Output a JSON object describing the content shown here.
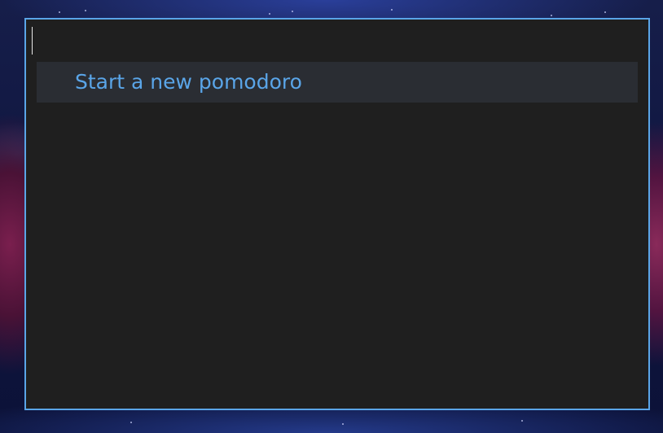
{
  "launcher": {
    "search": {
      "value": "",
      "placeholder": ""
    },
    "results": [
      {
        "label": "Start a new pomodoro",
        "selected": true
      }
    ]
  },
  "colors": {
    "accent": "#5aa5e8",
    "panel_background": "#1f1f1f",
    "selected_row": "#2a2d33"
  }
}
